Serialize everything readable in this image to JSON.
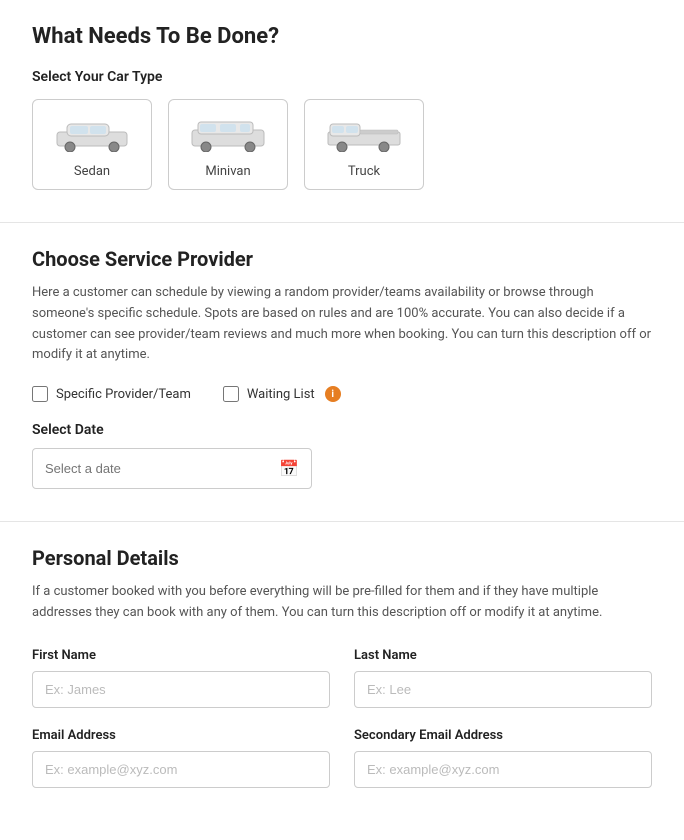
{
  "page": {
    "section1_title": "What Needs To Be Done?",
    "car_type_label": "Select Your Car Type",
    "car_options": [
      {
        "id": "sedan",
        "label": "Sedan"
      },
      {
        "id": "minivan",
        "label": "Minivan"
      },
      {
        "id": "truck",
        "label": "Truck"
      }
    ],
    "section2_title": "Choose Service Provider",
    "section2_description": "Here a customer can schedule by viewing a random provider/teams availability or browse through someone's specific schedule. Spots are based on rules and are 100% accurate. You can also decide if a customer can see provider/team reviews and much more when booking. You can turn this description off or modify it at anytime.",
    "checkbox_specific": "Specific Provider/Team",
    "checkbox_waiting": "Waiting List",
    "select_date_label": "Select Date",
    "date_placeholder": "Select a date",
    "section3_title": "Personal Details",
    "section3_description": "If a customer booked with you before everything will be pre-filled for them and if they have multiple addresses they can book with any of them. You can turn this description off or modify it at anytime.",
    "first_name_label": "First Name",
    "first_name_placeholder": "Ex: James",
    "last_name_label": "Last Name",
    "last_name_placeholder": "Ex: Lee",
    "email_label": "Email Address",
    "email_placeholder": "Ex: example@xyz.com",
    "secondary_email_label": "Secondary Email Address",
    "secondary_email_placeholder": "Ex: example@xyz.com"
  }
}
